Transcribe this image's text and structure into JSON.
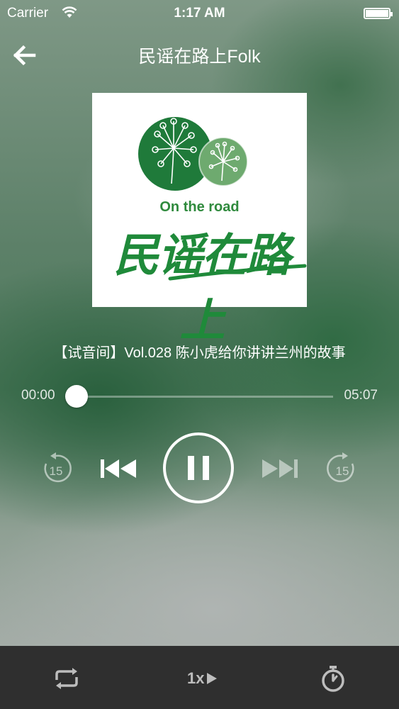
{
  "status_bar": {
    "carrier": "Carrier",
    "time": "1:17 AM"
  },
  "nav": {
    "title": "民谣在路上Folk"
  },
  "cover": {
    "subtitle": "On the road",
    "name": "民谣在路上",
    "brand_color": "#2f8a3d"
  },
  "track": {
    "title": "【试音间】Vol.028 陈小虎给你讲讲兰州的故事"
  },
  "progress": {
    "elapsed": "00:00",
    "total": "05:07",
    "fraction": 0.0
  },
  "controls": {
    "rewind_label": "15",
    "forward_label": "15",
    "state": "playing"
  },
  "bottom_bar": {
    "speed": "1x",
    "icons": [
      "repeat-icon",
      "play-triangle-icon",
      "stopwatch-icon"
    ]
  }
}
